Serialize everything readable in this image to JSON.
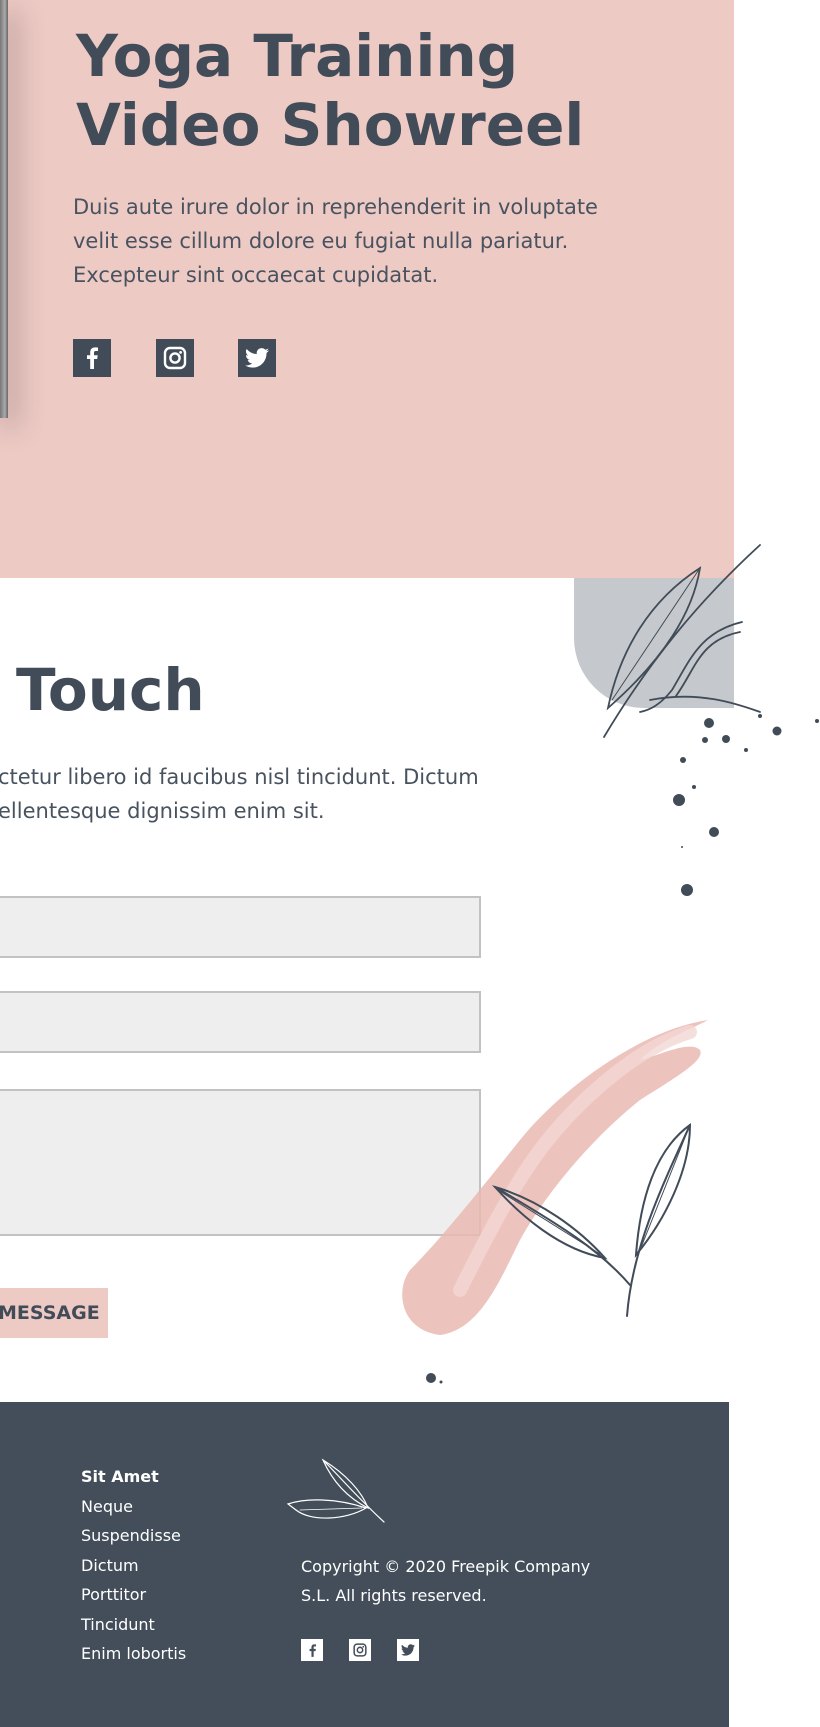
{
  "hero": {
    "title": "Yoga Training\nVideo Showreel",
    "description": "Duis aute irure dolor in reprehenderit in voluptate velit esse cillum dolore eu fugiat nulla pariatur. Excepteur sint occaecat cupidatat.",
    "social": [
      {
        "icon": "facebook-icon"
      },
      {
        "icon": "instagram-icon"
      },
      {
        "icon": "twitter-icon"
      }
    ]
  },
  "contact": {
    "title": "Touch",
    "description": "ctetur libero id faucibus nisl tincidunt. Dictum ellentesque dignissim enim sit.",
    "send_label": "MESSAGE"
  },
  "footer": {
    "links": [
      "Sit Amet",
      "Neque",
      "Suspendisse",
      "Dictum",
      "Porttitor",
      "Tincidunt",
      "Enim lobortis"
    ],
    "copyright": "Copyright ©  2020 Freepik Company S.L. All rights reserved.",
    "social": [
      {
        "icon": "facebook-icon"
      },
      {
        "icon": "instagram-icon"
      },
      {
        "icon": "twitter-icon"
      }
    ]
  },
  "colors": {
    "pink": "#eecac5",
    "slate": "#414c58",
    "footer_bg": "#434e5a",
    "field_bg": "#eeeeee",
    "blob_gray": "#c5c9cd"
  }
}
